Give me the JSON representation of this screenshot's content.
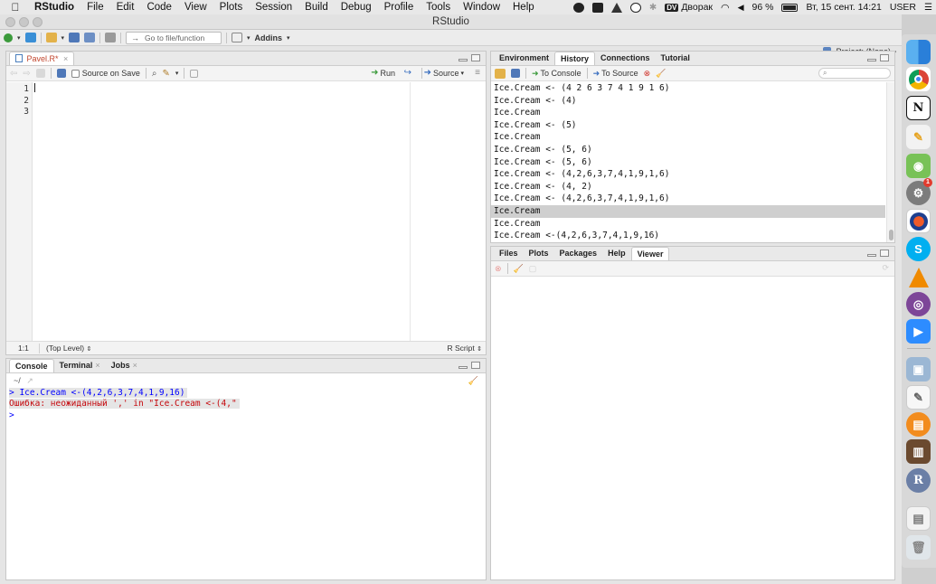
{
  "menubar": {
    "app": "RStudio",
    "items": [
      "File",
      "Edit",
      "Code",
      "View",
      "Plots",
      "Session",
      "Build",
      "Debug",
      "Profile",
      "Tools",
      "Window",
      "Help"
    ],
    "keyboard_layout_badge": "DV",
    "keyboard_layout": "Дворак",
    "battery": "96 %",
    "datetime": "Вт, 15 сент.  14:21",
    "user": "USER"
  },
  "window": {
    "title": "RStudio"
  },
  "toolbar": {
    "goto_placeholder": "Go to file/function",
    "addins": "Addins",
    "project": "Project: (None)"
  },
  "editor": {
    "tab_label": "Pavel.R*",
    "source_on_save": "Source on Save",
    "run": "Run",
    "source": "Source",
    "line_numbers": [
      "1",
      "2",
      "3"
    ],
    "status_position": "1:1",
    "status_scope": "(Top Level)",
    "status_type": "R Script"
  },
  "console": {
    "tabs": [
      "Console",
      "Terminal",
      "Jobs"
    ],
    "path": "~/",
    "lines": [
      {
        "text": "> Ice.Cream <-(4,2,6,3,7,4,1,9,16)",
        "kind": "input"
      },
      {
        "text": "Ошибка: неожиданный ',' in \"Ice.Cream <-(4,\"",
        "kind": "error"
      },
      {
        "text": ">",
        "kind": "prompt"
      }
    ]
  },
  "history": {
    "tabs": [
      "Environment",
      "History",
      "Connections",
      "Tutorial"
    ],
    "to_console": "To Console",
    "to_source": "To Source",
    "selected_index": 10,
    "entries": [
      "Ice.Cream <- (4 2 6 3 7 4 1 9 1 6)",
      "Ice.Cream <- (4)",
      "Ice.Cream",
      "Ice.Cream <- (5)",
      "Ice.Cream",
      "Ice.Cream <- (5, 6)",
      "Ice.Cream <- (5, 6)",
      "Ice.Cream <- (4,2,6,3,7,4,1,9,1,6)",
      "Ice.Cream <- (4, 2)",
      "Ice.Cream <- (4,2,6,3,7,4,1,9,1,6)",
      "Ice.Cream",
      "Ice.Cream",
      "Ice.Cream <-(4,2,6,3,7,4,1,9,16)"
    ]
  },
  "files": {
    "tabs": [
      "Files",
      "Plots",
      "Packages",
      "Help",
      "Viewer"
    ]
  },
  "dock": {
    "icons": [
      "finder",
      "chrome",
      "notion",
      "pages",
      "android-studio",
      "system-preferences",
      "safari-like",
      "skype",
      "vlc",
      "tor",
      "zoom",
      "preview",
      "textedit",
      "books",
      "calibre",
      "r",
      "document",
      "trash"
    ],
    "notification_badge": "1",
    "r_label": "R",
    "skype_label": "S",
    "notion_label": "N"
  },
  "colors": {
    "error": "#c5060b",
    "input": "#0000ff",
    "accent": "#1a73e8"
  }
}
